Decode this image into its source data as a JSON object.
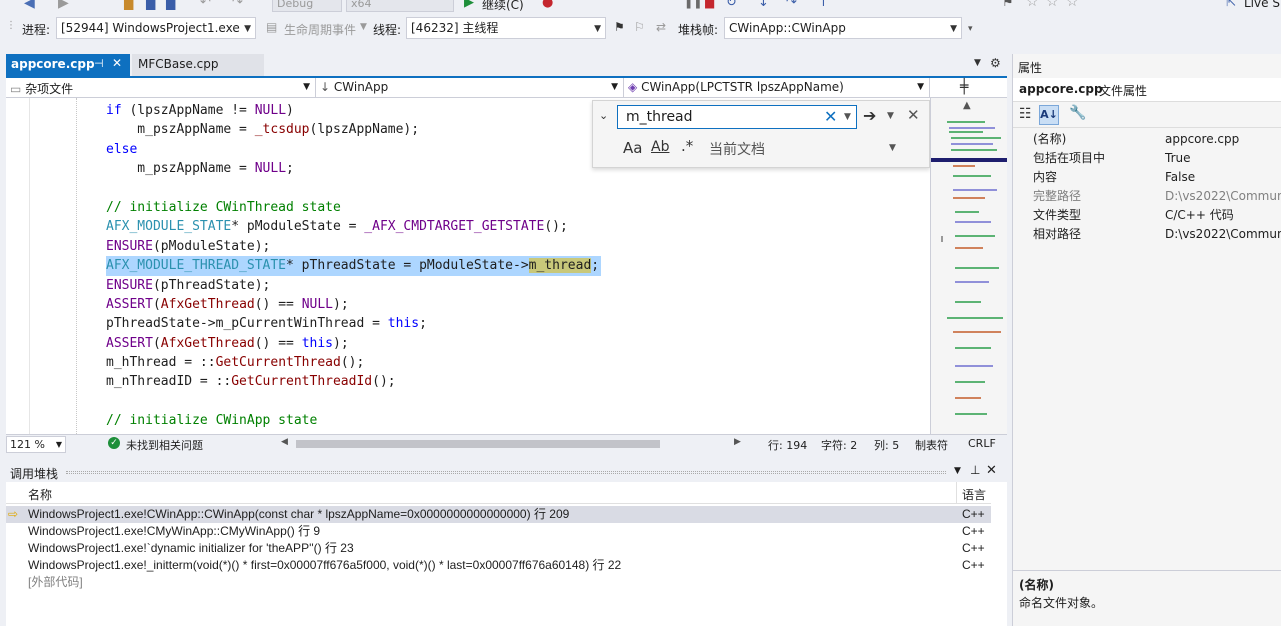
{
  "toolbar": {
    "debug_combo": "Debug",
    "platform_combo": "x64",
    "continue_label": "继续(C)",
    "live_share": "Live S"
  },
  "debug_location": {
    "process_label": "进程:",
    "process_value": "[52944] WindowsProject1.exe",
    "lifecycle_label": "生命周期事件",
    "thread_label": "线程:",
    "thread_value": "[46232] 主线程",
    "stackframe_label": "堆栈帧:",
    "stackframe_value": "CWinApp::CWinApp"
  },
  "tabs": [
    {
      "label": "appcore.cpp",
      "active": true
    },
    {
      "label": "MFCBase.cpp",
      "active": false
    }
  ],
  "navbar": {
    "project": "杂项文件",
    "scope": "CWinApp",
    "member": "CWinApp(LPCTSTR lpszAppName)"
  },
  "code_lines": [
    [
      {
        "t": "if",
        "c": "kw"
      },
      {
        "t": " (lpszAppName != ",
        "c": "plain"
      },
      {
        "t": "NULL",
        "c": "mac"
      },
      {
        "t": ")",
        "c": "plain"
      }
    ],
    [
      {
        "t": "    m_pszAppName = ",
        "c": "plain"
      },
      {
        "t": "_tcsdup",
        "c": "fn"
      },
      {
        "t": "(lpszAppName);",
        "c": "plain"
      }
    ],
    [
      {
        "t": "else",
        "c": "kw"
      }
    ],
    [
      {
        "t": "    m_pszAppName = ",
        "c": "plain"
      },
      {
        "t": "NULL",
        "c": "mac"
      },
      {
        "t": ";",
        "c": "plain"
      }
    ],
    [],
    [
      {
        "t": "// initialize CWinThread state",
        "c": "cm"
      }
    ],
    [
      {
        "t": "AFX_MODULE_STATE",
        "c": "tp"
      },
      {
        "t": "* pModuleState = ",
        "c": "plain"
      },
      {
        "t": "_AFX_CMDTARGET_GETSTATE",
        "c": "mac"
      },
      {
        "t": "();",
        "c": "plain"
      }
    ],
    [
      {
        "t": "ENSURE",
        "c": "mac"
      },
      {
        "t": "(pModuleState);",
        "c": "plain"
      }
    ],
    [
      {
        "t": "AFX_MODULE_THREAD_STATE",
        "c": "tp"
      },
      {
        "t": "* pThreadState = pModuleState->",
        "c": "plain"
      },
      {
        "t": "m_thread",
        "c": "plain",
        "hl2": true
      },
      {
        "t": ";",
        "c": "plain"
      }
    ],
    [
      {
        "t": "ENSURE",
        "c": "mac"
      },
      {
        "t": "(pThreadState);",
        "c": "plain"
      }
    ],
    [
      {
        "t": "ASSERT",
        "c": "mac"
      },
      {
        "t": "(",
        "c": "plain"
      },
      {
        "t": "AfxGetThread",
        "c": "fn"
      },
      {
        "t": "() == ",
        "c": "plain"
      },
      {
        "t": "NULL",
        "c": "mac"
      },
      {
        "t": ");",
        "c": "plain"
      }
    ],
    [
      {
        "t": "pThreadState->m_pCurrentWinThread = ",
        "c": "plain"
      },
      {
        "t": "this",
        "c": "kw"
      },
      {
        "t": ";",
        "c": "plain"
      }
    ],
    [
      {
        "t": "ASSERT",
        "c": "mac"
      },
      {
        "t": "(",
        "c": "plain"
      },
      {
        "t": "AfxGetThread",
        "c": "fn"
      },
      {
        "t": "() == ",
        "c": "plain"
      },
      {
        "t": "this",
        "c": "kw"
      },
      {
        "t": ");",
        "c": "plain"
      }
    ],
    [
      {
        "t": "m_hThread = ::",
        "c": "plain"
      },
      {
        "t": "GetCurrentThread",
        "c": "fn"
      },
      {
        "t": "();",
        "c": "plain"
      }
    ],
    [
      {
        "t": "m_nThreadID = ::",
        "c": "plain"
      },
      {
        "t": "GetCurrentThreadId",
        "c": "fn"
      },
      {
        "t": "();",
        "c": "plain"
      }
    ],
    [],
    [
      {
        "t": "// initialize CWinApp state",
        "c": "cm"
      }
    ]
  ],
  "find": {
    "query": "m_thread",
    "scope": "当前文档",
    "match_case_icon": "Aa",
    "whole_word_icon": "Ab",
    "regex_icon": ".*"
  },
  "editor_status": {
    "zoom": "121 %",
    "issues": "未找到相关问题",
    "line": "行: 194",
    "char": "字符: 2",
    "col": "列: 5",
    "tabs": "制表符",
    "eol": "CRLF"
  },
  "callstack": {
    "title": "调用堆栈",
    "col_name": "名称",
    "col_lang": "语言",
    "rows": [
      {
        "name": "WindowsProject1.exe!CWinApp::CWinApp(const char * lpszAppName=0x0000000000000000) 行 209",
        "lang": "C++",
        "current": true
      },
      {
        "name": "WindowsProject1.exe!CMyWinApp::CMyWinApp() 行 9",
        "lang": "C++",
        "current": false
      },
      {
        "name": "WindowsProject1.exe!`dynamic initializer for 'theAPP''() 行 23",
        "lang": "C++",
        "current": false
      },
      {
        "name": "WindowsProject1.exe!_initterm(void(*)() * first=0x00007ff676a5f000, void(*)() * last=0x00007ff676a60148) 行 22",
        "lang": "C++",
        "current": false
      },
      {
        "name": "[外部代码]",
        "lang": "",
        "current": false,
        "external": true
      }
    ]
  },
  "properties": {
    "title": "属性",
    "object": "appcore.cpp",
    "object_type": "文件属性",
    "rows": [
      {
        "key": "(名称)",
        "value": "appcore.cpp",
        "muted": false
      },
      {
        "key": "包括在项目中",
        "value": "True",
        "muted": false
      },
      {
        "key": "内容",
        "value": "False",
        "muted": false
      },
      {
        "key": "完整路径",
        "value": "D:\\vs2022\\Communi",
        "muted": true
      },
      {
        "key": "文件类型",
        "value": "C/C++ 代码",
        "muted": false
      },
      {
        "key": "相对路径",
        "value": "D:\\vs2022\\Communi",
        "muted": false
      }
    ],
    "desc_title": "(名称)",
    "desc_text": "命名文件对象。"
  },
  "colors": {
    "accent": "#0e70c0",
    "selection": "#add6ff",
    "current_row": "#d9dbe4"
  }
}
